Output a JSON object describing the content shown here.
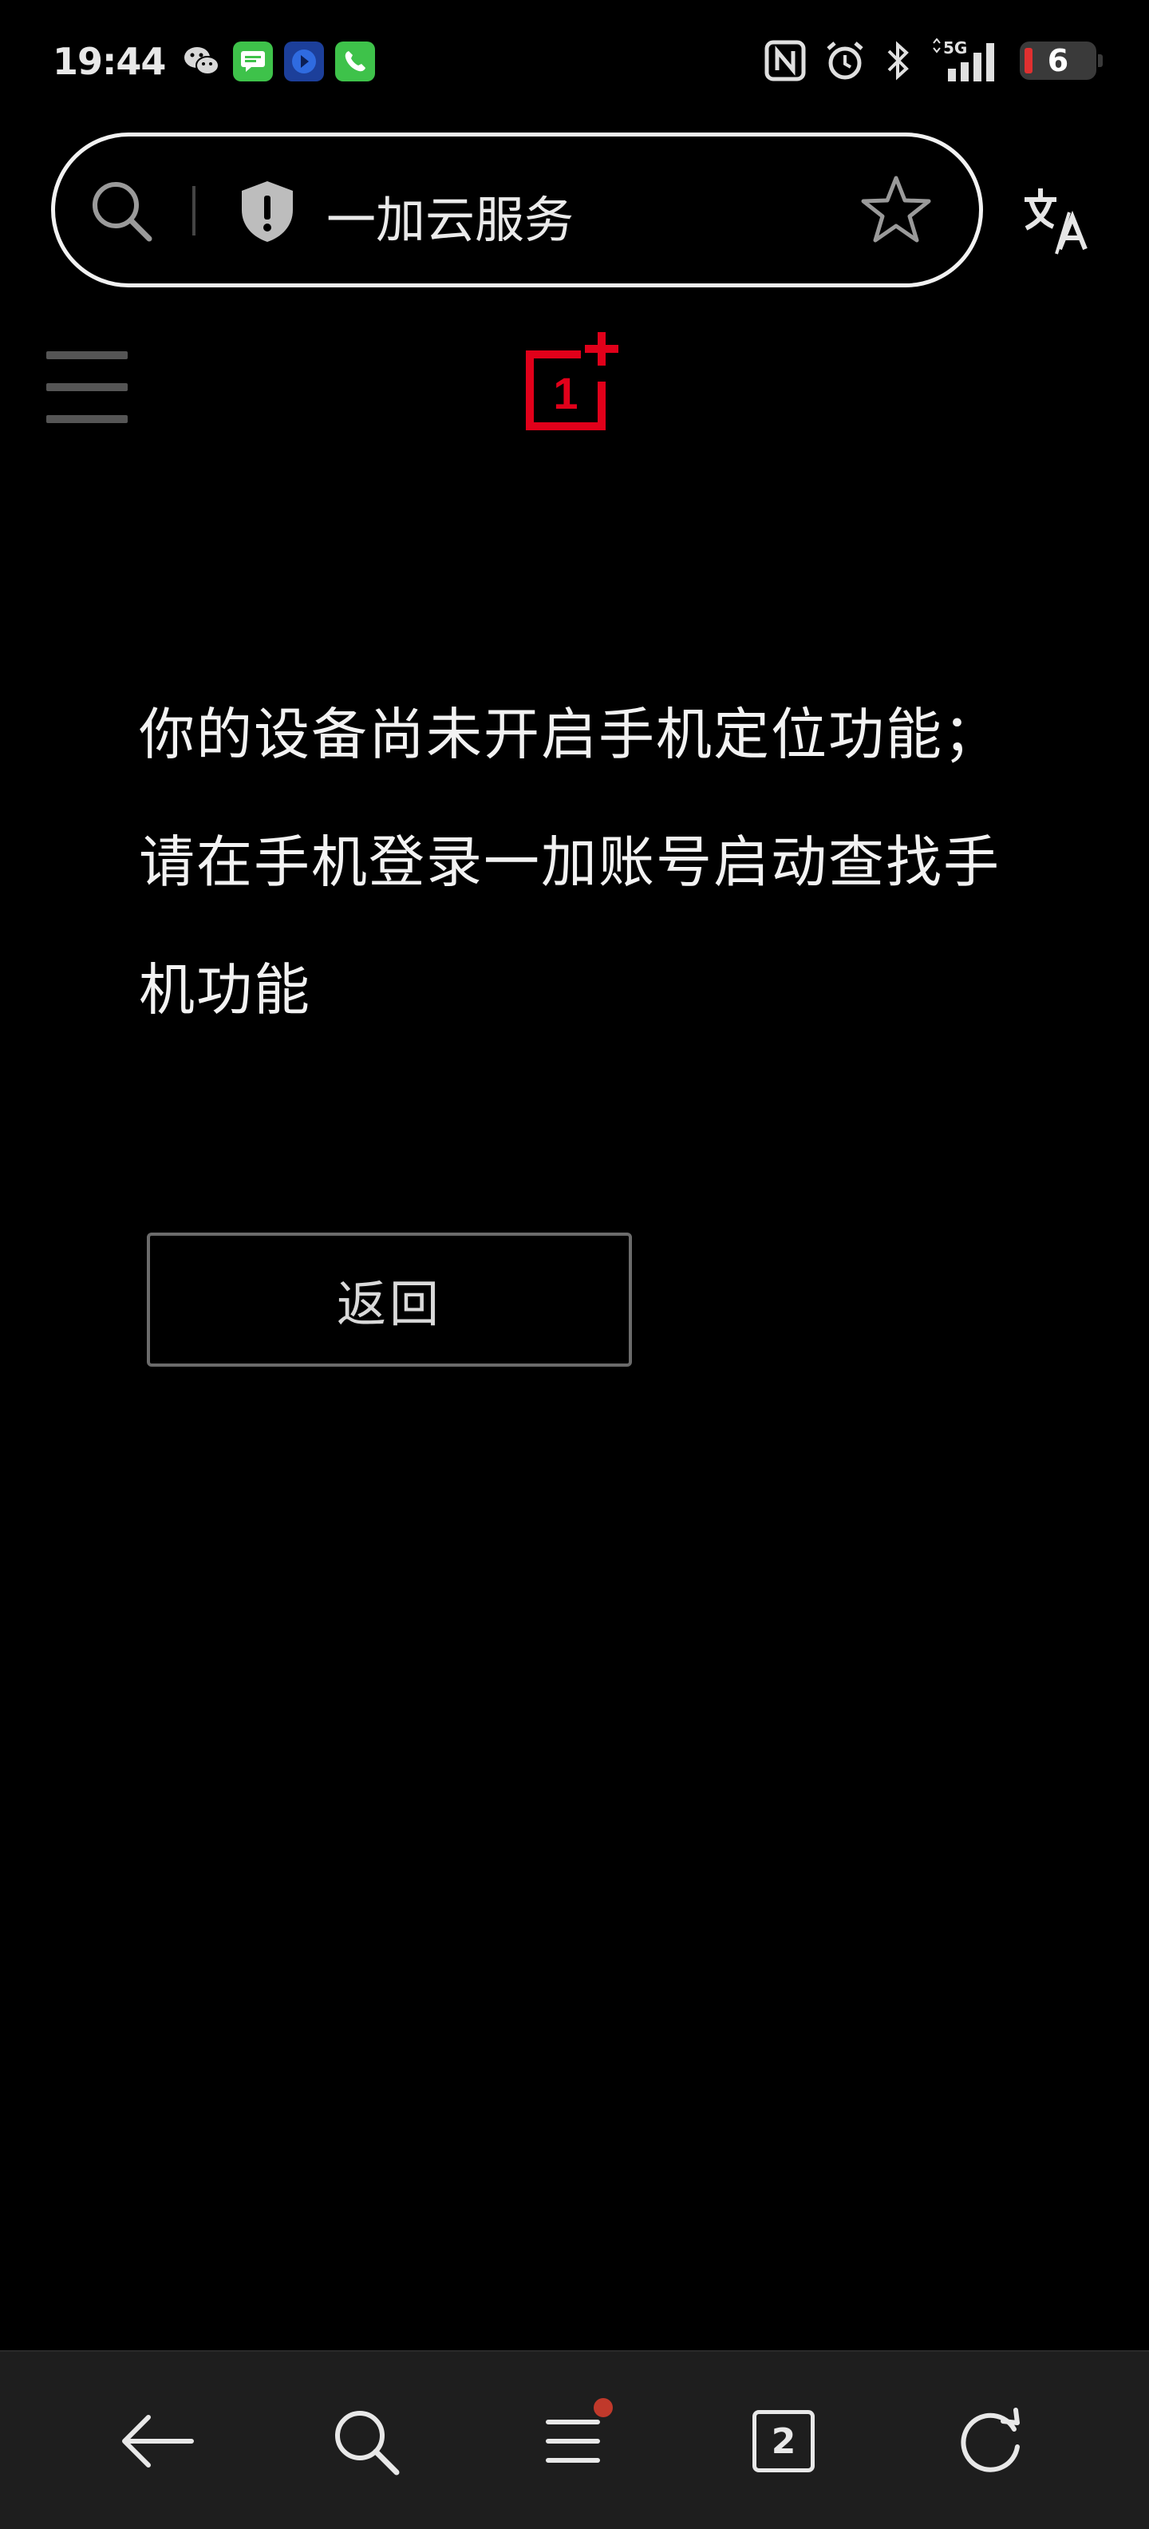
{
  "status_bar": {
    "time": "19:44",
    "notification_icons": [
      "wechat-icon",
      "messages-icon",
      "app-icon",
      "phone-icon"
    ],
    "system_icons": [
      "nfc-icon",
      "alarm-icon",
      "bluetooth-icon",
      "signal-5g-icon"
    ],
    "network_label": "5G",
    "battery_level": "6"
  },
  "address_bar": {
    "title": "一加云服务"
  },
  "site": {
    "logo_text": "1",
    "brand_color": "#e1001a"
  },
  "message": {
    "line1": "你的设备尚未开启手机定位功能；",
    "line2": "请在手机登录一加账号启动查找手",
    "line3": "机功能"
  },
  "actions": {
    "back_label": "返回"
  },
  "toolbar": {
    "tab_count": "2",
    "menu_badge_color": "#c0392b"
  }
}
